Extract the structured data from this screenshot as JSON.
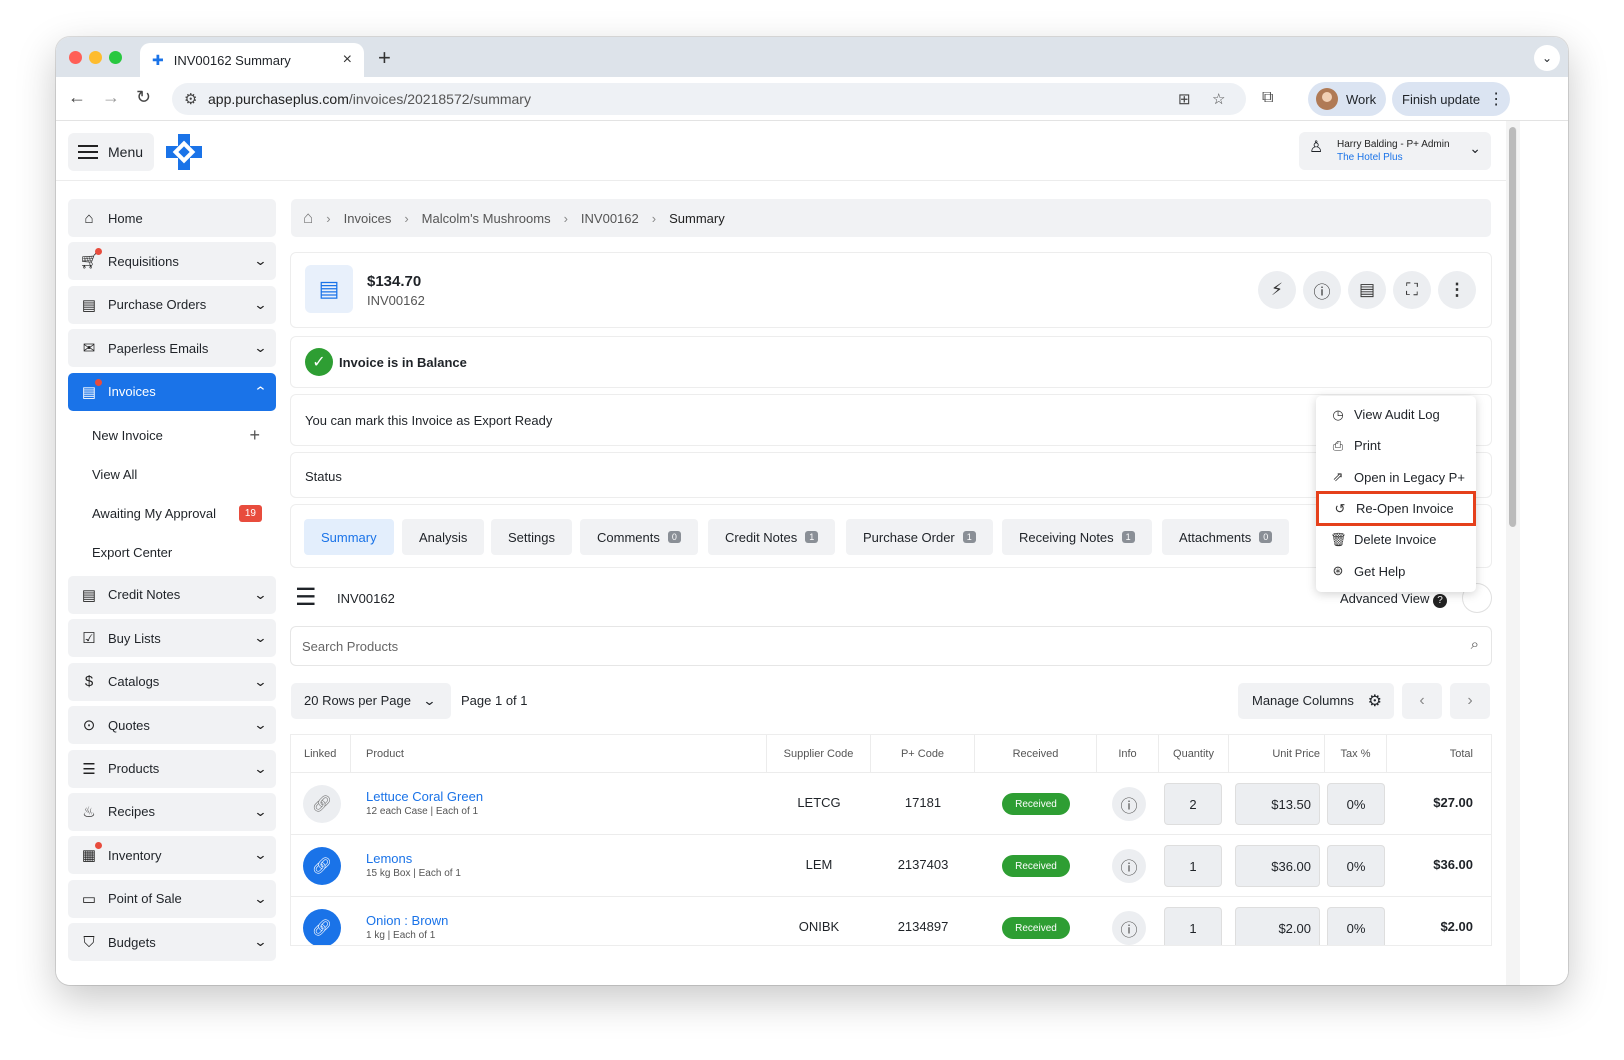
{
  "browser": {
    "tab_title": "INV00162 Summary",
    "url_host": "app.purchaseplus.com",
    "url_path": "/invoices/20218572/summary",
    "profile_label": "Work",
    "finish_update_label": "Finish update"
  },
  "app": {
    "menu_label": "Menu",
    "user_name": "Harry Balding - P+ Admin",
    "user_org": "The Hotel Plus"
  },
  "sidebar": {
    "items": [
      {
        "label": "Home",
        "icon": "home-icon"
      },
      {
        "label": "Requisitions",
        "icon": "cart-icon"
      },
      {
        "label": "Purchase Orders",
        "icon": "clipboard-icon"
      },
      {
        "label": "Paperless Emails",
        "icon": "mail-icon"
      },
      {
        "label": "Invoices",
        "icon": "invoice-icon"
      }
    ],
    "sub_items": [
      {
        "label": "New Invoice"
      },
      {
        "label": "View All"
      },
      {
        "label": "Awaiting My Approval",
        "badge": "19"
      },
      {
        "label": "Export Center"
      }
    ],
    "more_items": [
      {
        "label": "Credit Notes"
      },
      {
        "label": "Buy Lists"
      },
      {
        "label": "Catalogs"
      },
      {
        "label": "Quotes"
      },
      {
        "label": "Products"
      },
      {
        "label": "Recipes"
      },
      {
        "label": "Inventory"
      },
      {
        "label": "Point of Sale"
      },
      {
        "label": "Budgets"
      }
    ]
  },
  "breadcrumb": [
    "Invoices",
    "Malcolm's Mushrooms",
    "INV00162",
    "Summary"
  ],
  "invoice": {
    "amount": "$134.70",
    "number": "INV00162",
    "balance_text": "Invoice is in Balance",
    "export_text": "You can mark this Invoice as Export Ready",
    "status_label": "Status"
  },
  "tabs": [
    {
      "label": "Summary"
    },
    {
      "label": "Analysis"
    },
    {
      "label": "Settings"
    },
    {
      "label": "Comments",
      "count": "0"
    },
    {
      "label": "Credit Notes",
      "count": "1"
    },
    {
      "label": "Purchase Order",
      "count": "1"
    },
    {
      "label": "Receiving Notes",
      "count": "1"
    },
    {
      "label": "Attachments",
      "count": "0"
    }
  ],
  "products": {
    "heading": "INV00162",
    "advanced_view_label": "Advanced View",
    "search_placeholder": "Search Products",
    "rows_per_page": "20 Rows per Page",
    "page_info": "Page 1 of 1",
    "manage_columns": "Manage Columns",
    "columns": [
      "Linked",
      "Product",
      "Supplier Code",
      "P+ Code",
      "Received",
      "Info",
      "Quantity",
      "Unit Price",
      "Tax %",
      "Total"
    ],
    "rows": [
      {
        "name": "Lettuce Coral Green",
        "desc": "12 each Case | Each of 1",
        "supplier_code": "LETCG",
        "p_code": "17181",
        "status": "Received",
        "qty": "2",
        "unit_price": "$13.50",
        "tax": "0%",
        "total": "$27.00"
      },
      {
        "name": "Lemons",
        "desc": "15 kg Box | Each of 1",
        "supplier_code": "LEM",
        "p_code": "2137403",
        "status": "Received",
        "qty": "1",
        "unit_price": "$36.00",
        "tax": "0%",
        "total": "$36.00"
      },
      {
        "name": "Onion : Brown",
        "desc": "1 kg | Each of 1",
        "supplier_code": "ONIBK",
        "p_code": "2134897",
        "status": "Received",
        "qty": "1",
        "unit_price": "$2.00",
        "tax": "0%",
        "total": "$2.00"
      }
    ]
  },
  "dropdown": {
    "items": [
      {
        "label": "View Audit Log"
      },
      {
        "label": "Print"
      },
      {
        "label": "Open in Legacy P+"
      },
      {
        "label": "Re-Open Invoice"
      },
      {
        "label": "Delete Invoice"
      },
      {
        "label": "Get Help"
      }
    ]
  },
  "colors": {
    "accent": "#1a73e8",
    "success": "#2e9e33",
    "alert": "#e84c3d",
    "highlight": "#e5401b"
  }
}
